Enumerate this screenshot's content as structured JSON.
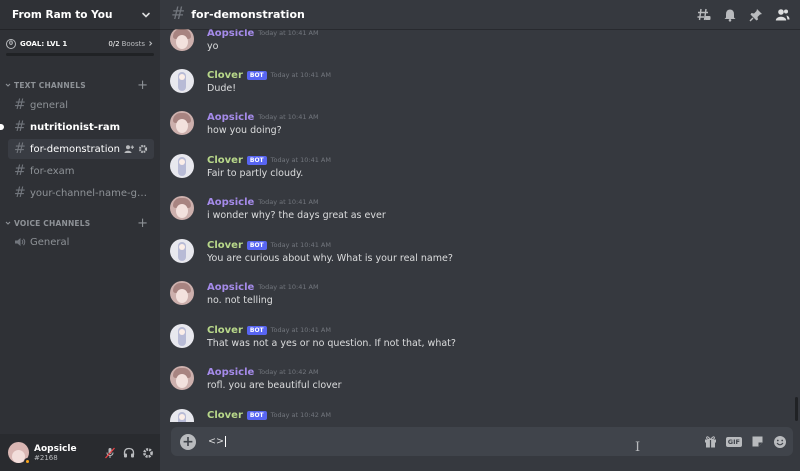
{
  "server": {
    "name": "From Ram to You",
    "goal_label": "GOAL: LVL 1",
    "boost_count": "0/2",
    "boost_label": "Boosts",
    "goal_progress": 0
  },
  "categories": {
    "text": "TEXT CHANNELS",
    "voice": "VOICE CHANNELS"
  },
  "channels": [
    {
      "name": "general",
      "state": "normal"
    },
    {
      "name": "nutritionist-ram",
      "state": "unread"
    },
    {
      "name": "for-demonstration",
      "state": "selected"
    },
    {
      "name": "for-exam",
      "state": "normal"
    },
    {
      "name": "your-channel-name-goes...",
      "state": "normal"
    }
  ],
  "voice_channels": [
    {
      "name": "General"
    }
  ],
  "header": {
    "channel_name": "for-demonstration"
  },
  "user": {
    "name": "Aopsicle",
    "tag": "#2168",
    "status_color": "#faa61a"
  },
  "colors": {
    "accent": "#5865f2",
    "aopsicle_name": "#a58bea",
    "clover_name": "#b8d88a"
  },
  "bot_tag": "BOT",
  "messages": [
    {
      "author": "Aopsicle",
      "bot": false,
      "time": "Today at 10:41 AM",
      "text": "yo"
    },
    {
      "author": "Clover",
      "bot": true,
      "time": "Today at 10:41 AM",
      "text": "Dude!"
    },
    {
      "author": "Aopsicle",
      "bot": false,
      "time": "Today at 10:41 AM",
      "text": "how you doing?"
    },
    {
      "author": "Clover",
      "bot": true,
      "time": "Today at 10:41 AM",
      "text": "Fair to partly cloudy."
    },
    {
      "author": "Aopsicle",
      "bot": false,
      "time": "Today at 10:41 AM",
      "text": "i wonder why? the days great as ever"
    },
    {
      "author": "Clover",
      "bot": true,
      "time": "Today at 10:41 AM",
      "text": "You are curious about why.  What is your real name?"
    },
    {
      "author": "Aopsicle",
      "bot": false,
      "time": "Today at 10:41 AM",
      "text": "no. not telling"
    },
    {
      "author": "Clover",
      "bot": true,
      "time": "Today at 10:41 AM",
      "text": "That was not a yes or no question.  If not that, what?"
    },
    {
      "author": "Aopsicle",
      "bot": false,
      "time": "Today at 10:42 AM",
      "text": "rofl. you are beautiful clover"
    },
    {
      "author": "Clover",
      "bot": true,
      "time": "Today at 10:42 AM",
      "text": ""
    }
  ],
  "composer": {
    "value": "<>"
  },
  "icons": {
    "header": [
      "threads-icon",
      "bell-icon",
      "pin-icon",
      "members-icon"
    ],
    "composer": [
      "gift-icon",
      "gif-icon",
      "sticker-icon",
      "emoji-icon"
    ],
    "user_controls": [
      "mute-icon",
      "headphones-icon",
      "settings-gear-icon"
    ]
  }
}
